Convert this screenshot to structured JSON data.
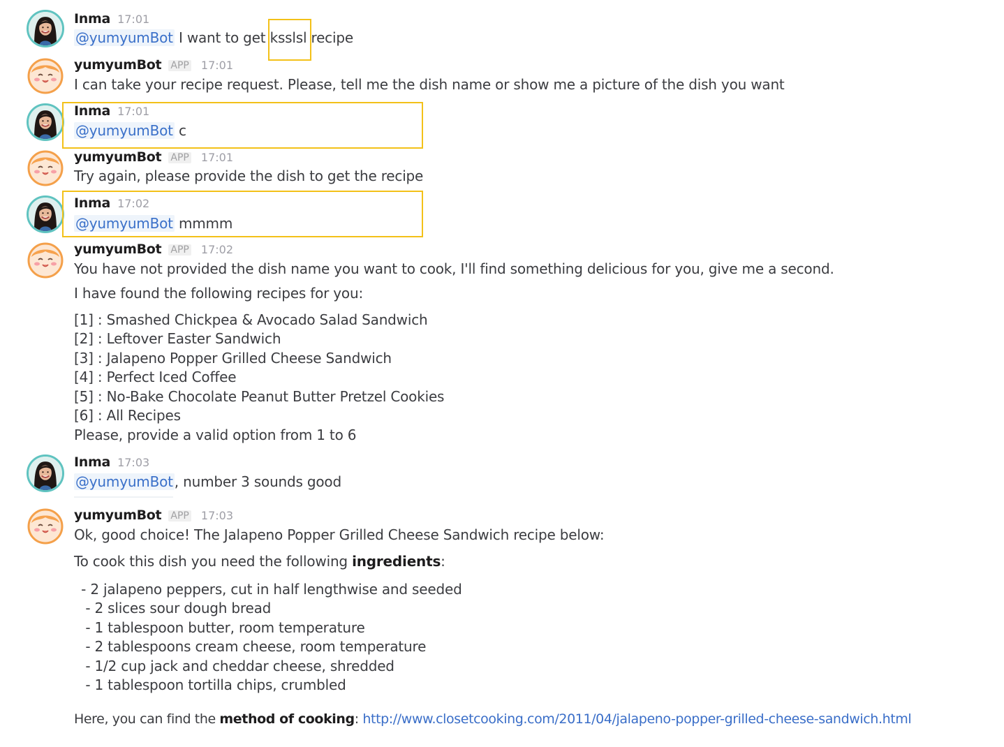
{
  "users": {
    "inma": "Inma",
    "bot": "yumyumBot",
    "app_badge": "APP",
    "mention": "@yumyumBot"
  },
  "messages": [
    {
      "time": "17:01",
      "text_before": "I want to get ",
      "highlight_word": "ksslsl",
      "text_after": " recipe"
    },
    {
      "time": "17:01",
      "text": "I can take your recipe request. Please, tell me the dish name or show me a picture of the dish you want"
    },
    {
      "time": "17:01",
      "text": "c"
    },
    {
      "time": "17:01",
      "text": "Try again, please provide the dish to get the recipe"
    },
    {
      "time": "17:02",
      "text": "mmmm"
    },
    {
      "time": "17:02",
      "line1": "You have not provided the dish name you want to cook, I'll find something delicious for you, give me a second.",
      "line2": "I have found the following recipes for you:",
      "options": [
        "[1] :  Smashed Chickpea & Avocado Salad Sandwich",
        "[2] :  Leftover Easter Sandwich",
        "[3] :  Jalapeno Popper Grilled Cheese Sandwich",
        "[4] :  Perfect Iced Coffee",
        "[5] :  No-Bake Chocolate Peanut Butter Pretzel Cookies",
        "[6] :  All Recipes"
      ],
      "footer": "Please, provide a valid option from 1 to 6"
    },
    {
      "time": "17:03",
      "text": ", number 3 sounds good"
    },
    {
      "time": "17:03",
      "line1": "Ok, good choice! The Jalapeno Popper Grilled Cheese Sandwich recipe below:",
      "ingredients_intro": "To cook this dish you need the following ",
      "ingredients_bold": "ingredients",
      "ingredients_colon": ":",
      "ingredients": [
        " - 2 jalapeno peppers, cut in half lengthwise and seeded",
        "  - 2 slices sour dough bread",
        "  - 1 tablespoon butter, room temperature",
        "  - 2 tablespoons cream cheese, room temperature",
        "  - 1/2 cup jack and cheddar cheese, shredded",
        "  - 1 tablespoon tortilla chips, crumbled"
      ],
      "method_intro": "Here, you can find the ",
      "method_bold": "method of cooking",
      "method_colon": ": ",
      "method_link": "http://www.closetcooking.com/2011/04/jalapeno-popper-grilled-cheese-sandwich.html"
    }
  ],
  "colors": {
    "mention": "#3a70c9",
    "highlight_box": "#f3c119",
    "link": "#3a6ec8"
  }
}
